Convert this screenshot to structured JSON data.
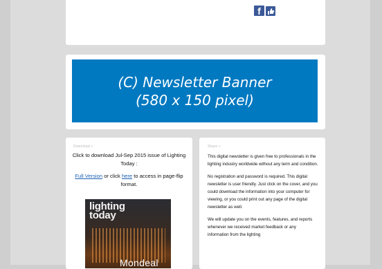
{
  "header": {
    "social_icon_letter": "f",
    "social_icon_name": "facebook-like-icon"
  },
  "banner": {
    "line1": "(C)   Newsletter Banner",
    "line2": "(580 x 150 pixel)",
    "background": "#0079c1"
  },
  "left_panel": {
    "heading": "Download »",
    "intro": "Click to download Jul-Sep 2015 issue of Lighting Today :",
    "full_version_link": "Full Version",
    "or_click_text": " or click ",
    "here_link": "here",
    "access_text": " to access in page-flip format.",
    "cover": {
      "masthead_line1": "lighting",
      "masthead_line2": "today",
      "title_word": "Mondeal"
    }
  },
  "right_panel": {
    "heading": "Share »",
    "paragraphs": [
      "This digital newsletter is given free to professionals in the lighting industry worldwide without any term and condition.",
      "No registration and password is required. This digital newsletter is user friendly. Just click on the cover, and you could download the information into your computer for viewing, or you could print out any page of the digital newsletter as well.",
      "We will update you on the events, features, and reports whenever we received market feedback or any information from the lighting"
    ]
  }
}
